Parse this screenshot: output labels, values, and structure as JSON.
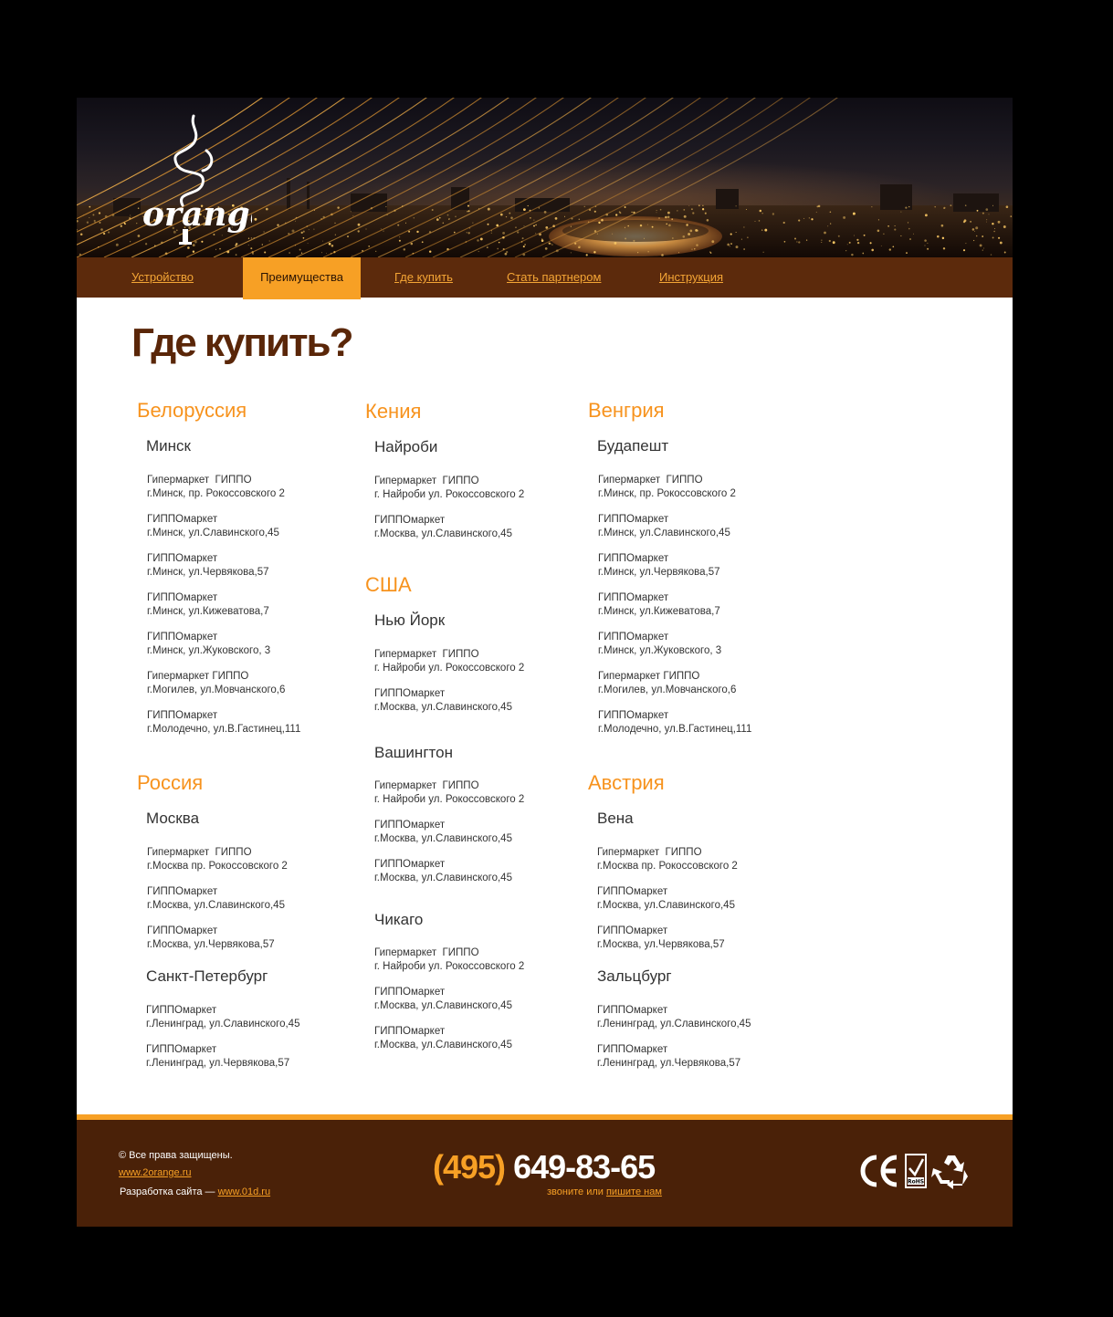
{
  "brand": {
    "logo_text": "orange"
  },
  "nav": {
    "items": [
      {
        "label": "Устройство"
      },
      {
        "label": "Преимущества",
        "active": true
      },
      {
        "label": "Где купить"
      },
      {
        "label": "Стать партнером"
      },
      {
        "label": "Инструкция"
      }
    ]
  },
  "main": {
    "title": "Где купить?",
    "countries": [
      {
        "name": "Белоруссия",
        "cities": [
          {
            "name": "Минск",
            "stores": [
              [
                "Гипермаркет  ГИППО",
                "г.Минск, пр. Рокоссовского 2"
              ],
              [
                "ГИППОмаркет",
                "г.Минск, ул.Славинского,45"
              ],
              [
                "ГИППОмаркет",
                "г.Минск, ул.Червякова,57"
              ],
              [
                "ГИППОмаркет",
                "г.Минск, ул.Кижеватова,7"
              ],
              [
                "ГИППОмаркет",
                "г.Минск, ул.Жуковского, 3"
              ],
              [
                "Гипермаркет ГИППО",
                "г.Могилев, ул.Мовчанского,6"
              ],
              [
                "ГИППОмаркет",
                "г.Молодечно, ул.В.Гастинец,111"
              ]
            ]
          }
        ]
      },
      {
        "name": "Кения",
        "cities": [
          {
            "name": "Найроби",
            "stores": [
              [
                "Гипермаркет  ГИППО",
                "г. Найроби ул. Рокоссовского 2"
              ],
              [
                "ГИППОмаркет",
                "г.Москва, ул.Славинского,45"
              ]
            ]
          }
        ]
      },
      {
        "name": "Венгрия",
        "cities": [
          {
            "name": "Будапешт",
            "stores": [
              [
                "Гипермаркет  ГИППО",
                "г.Минск, пр. Рокоссовского 2"
              ],
              [
                "ГИППОмаркет",
                "г.Минск, ул.Славинского,45"
              ],
              [
                "ГИППОмаркет",
                "г.Минск, ул.Червякова,57"
              ],
              [
                "ГИППОмаркет",
                "г.Минск, ул.Кижеватова,7"
              ],
              [
                "ГИППОмаркет",
                "г.Минск, ул.Жуковского, 3"
              ],
              [
                "Гипермаркет ГИППО",
                "г.Могилев, ул.Мовчанского,6"
              ],
              [
                "ГИППОмаркет",
                "г.Молодечно, ул.В.Гастинец,111"
              ]
            ]
          }
        ]
      },
      {
        "name": "США",
        "cities": [
          {
            "name": "Нью Йорк",
            "stores": [
              [
                "Гипермаркет  ГИППО",
                "г. Найроби ул. Рокоссовского 2"
              ],
              [
                "ГИППОмаркет",
                "г.Москва, ул.Славинского,45"
              ]
            ]
          },
          {
            "name": "Вашингтон",
            "stores": [
              [
                "Гипермаркет  ГИППО",
                "г. Найроби ул. Рокоссовского 2"
              ],
              [
                "ГИППОмаркет",
                "г.Москва, ул.Славинского,45"
              ],
              [
                "ГИППОмаркет",
                "г.Москва, ул.Славинского,45"
              ]
            ]
          },
          {
            "name": "Чикаго",
            "stores": [
              [
                "Гипермаркет  ГИППО",
                "г. Найроби ул. Рокоссовского 2"
              ],
              [
                "ГИППОмаркет",
                "г.Москва, ул.Славинского,45"
              ],
              [
                "ГИППОмаркет",
                "г.Москва, ул.Славинского,45"
              ]
            ]
          }
        ]
      },
      {
        "name": "Россия",
        "cities": [
          {
            "name": "Москва",
            "stores": [
              [
                "Гипермаркет  ГИППО",
                "г.Москва пр. Рокоссовского 2"
              ],
              [
                "ГИППОмаркет",
                "г.Москва, ул.Славинского,45"
              ],
              [
                "ГИППОмаркет",
                "г.Москва, ул.Червякова,57"
              ]
            ]
          },
          {
            "name": "Санкт-Петербург",
            "stores": [
              [
                "ГИППОмаркет",
                "г.Ленинград, ул.Славинского,45"
              ],
              [
                "ГИППОмаркет",
                "г.Ленинград, ул.Червякова,57"
              ]
            ]
          }
        ]
      },
      {
        "name": "Австрия",
        "cities": [
          {
            "name": "Вена",
            "stores": [
              [
                "Гипермаркет  ГИППО",
                "г.Москва пр. Рокоссовского 2"
              ],
              [
                "ГИППОмаркет",
                "г.Москва, ул.Славинского,45"
              ],
              [
                "ГИППОмаркет",
                "г.Москва, ул.Червякова,57"
              ]
            ]
          },
          {
            "name": "Зальцбург",
            "stores": [
              [
                "ГИППОмаркет",
                "г.Ленинград, ул.Славинского,45"
              ],
              [
                "ГИППОмаркет",
                "г.Ленинград, ул.Червякова,57"
              ]
            ]
          }
        ]
      }
    ]
  },
  "footer": {
    "copyright": "© Все права защищены.",
    "site_link": "www.2orange.ru",
    "dev_label": "Разработка  сайта —",
    "dev_link": "www.01d.ru",
    "phone_code": "(495)",
    "phone_number": "649-83-65",
    "call_text": "звоните или",
    "write_link": "пишите нам",
    "certs": [
      "ce-mark-icon",
      "rohs-icon",
      "recycle-icon"
    ]
  },
  "colors": {
    "accent": "#f7a025",
    "country_heading": "#f7931e",
    "nav_bg": "#5c2a0c",
    "footer_bg": "#4a2108",
    "title": "#5a2608"
  }
}
